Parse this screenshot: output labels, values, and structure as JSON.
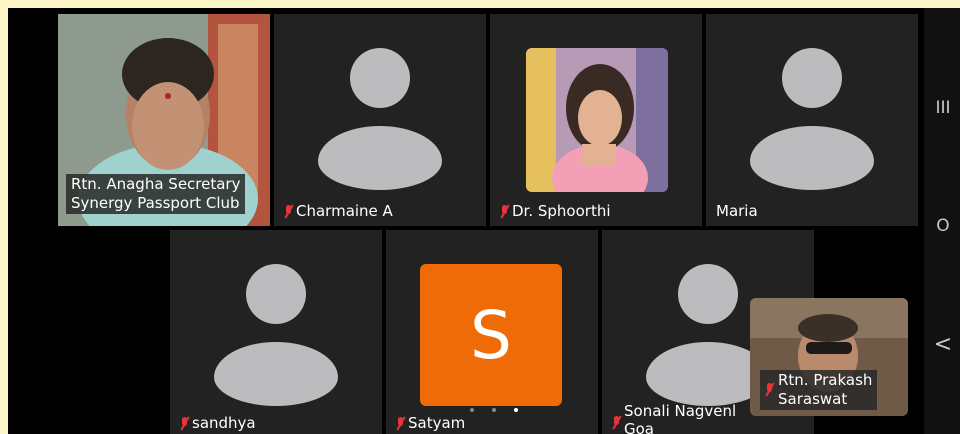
{
  "participants": [
    {
      "name": "Rtn. Anagha Secretary\nSynergy Passport Club",
      "line1": "Rtn. Anagha Secretary",
      "line2": "Synergy Passport Club",
      "muted": false,
      "speaking": true,
      "video": true
    },
    {
      "name": "Charmaine A",
      "muted": true,
      "video": false
    },
    {
      "name": "Dr. Sphoorthi",
      "muted": true,
      "video": true
    },
    {
      "name": "Maria",
      "muted": false,
      "video": false
    },
    {
      "name": "sandhya",
      "muted": true,
      "video": false
    },
    {
      "name": "Satyam",
      "muted": true,
      "video": false,
      "initial": "S"
    },
    {
      "name_line1": "Sonali Nagvenl",
      "name_line2": "Goa",
      "muted": true,
      "video": false
    }
  ],
  "self_view": {
    "line1": "Rtn. Prakash",
    "line2": "Saraswat",
    "muted": true
  },
  "nav": {
    "recents": "III",
    "home": "O",
    "back": "<"
  },
  "colors": {
    "speaking_border": "#3bd46a",
    "muted_mic": "#e8343a",
    "initial_avatar": "#ef6b07",
    "tile_bg": "#222222"
  },
  "pages": {
    "count": 3,
    "active": 3
  }
}
